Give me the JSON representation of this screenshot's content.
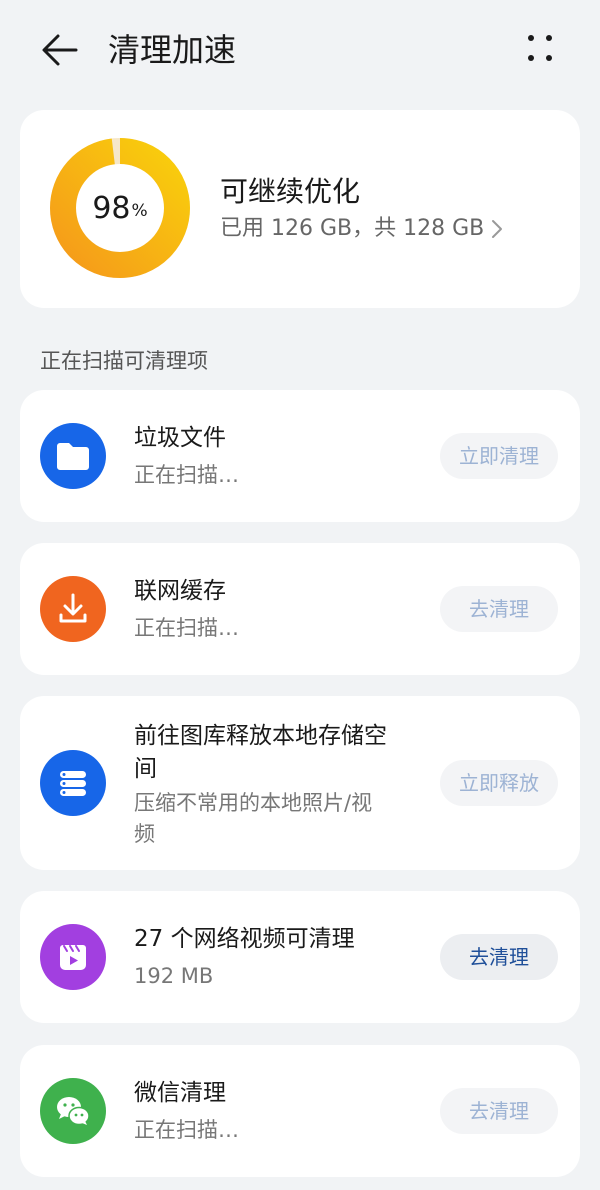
{
  "header": {
    "title": "清理加速",
    "back_icon": "arrow-left-icon",
    "more_icon": "more-dots-icon"
  },
  "storage": {
    "percent": "98",
    "percent_sign": "%",
    "percent_value": 0.98,
    "status": "可继续优化",
    "usage": "已用 126 GB，共 128 GB",
    "ring_colors": [
      "#f7a21b",
      "#f9c80e"
    ]
  },
  "section_title": "正在扫描可清理项",
  "items": [
    {
      "title": "垃圾文件",
      "subtitle": "正在扫描…",
      "action": "立即清理",
      "icon": "folder-icon",
      "icon_color": "#1766e8"
    },
    {
      "title": "联网缓存",
      "subtitle": "正在扫描…",
      "action": "去清理",
      "icon": "download-icon",
      "icon_color": "#f0651f"
    },
    {
      "title_line1": "前往图库释放本地存储空",
      "title_line2": "间",
      "subtitle_line1": "压缩不常用的本地照片/视",
      "subtitle_line2": "频",
      "action": "立即释放",
      "icon": "storage-stack-icon",
      "icon_color": "#1766e8"
    },
    {
      "title": "27 个网络视频可清理",
      "subtitle": "192 MB",
      "action": "去清理",
      "icon": "video-icon",
      "icon_color": "#a23fe0"
    },
    {
      "title": "微信清理",
      "subtitle": "正在扫描…",
      "action": "去清理",
      "icon": "wechat-icon",
      "icon_color": "#3fb14d"
    }
  ]
}
